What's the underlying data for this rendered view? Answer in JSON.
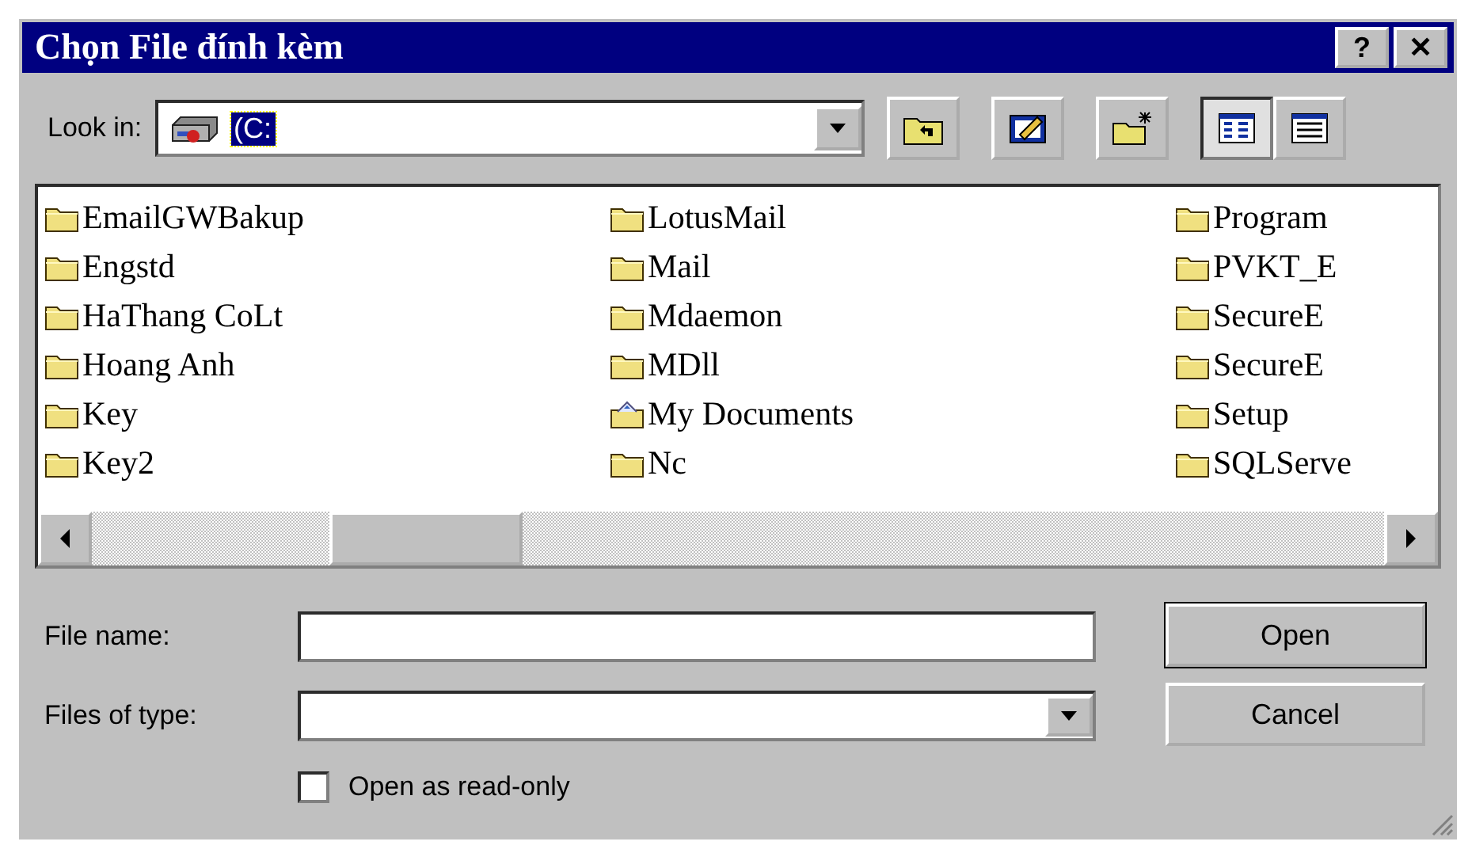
{
  "window": {
    "title": "Chọn File đính kèm",
    "title_buttons": [
      "?",
      "✕"
    ]
  },
  "look_in": {
    "label": "Look in:",
    "value": "(C:",
    "highlighted": true
  },
  "toolbar": [
    {
      "kind": "up",
      "pressed": false
    },
    {
      "kind": "desktop",
      "pressed": false
    },
    {
      "kind": "new-folder",
      "pressed": false
    },
    {
      "kind": "list",
      "pressed": true
    },
    {
      "kind": "details",
      "pressed": false
    }
  ],
  "files": [
    [
      {
        "name": "EmailGWBakup",
        "kind": "folder"
      },
      {
        "name": "Engstd",
        "kind": "folder"
      },
      {
        "name": "HaThang CoLt",
        "kind": "folder"
      },
      {
        "name": "Hoang Anh",
        "kind": "folder"
      },
      {
        "name": "Key",
        "kind": "folder"
      },
      {
        "name": "Key2",
        "kind": "folder"
      }
    ],
    [
      {
        "name": "LotusMail",
        "kind": "folder"
      },
      {
        "name": "Mail",
        "kind": "folder"
      },
      {
        "name": "Mdaemon",
        "kind": "folder"
      },
      {
        "name": "MDll",
        "kind": "folder"
      },
      {
        "name": "My Documents",
        "kind": "documents"
      },
      {
        "name": "Nc",
        "kind": "folder"
      }
    ],
    [
      {
        "name": "Program",
        "kind": "folder"
      },
      {
        "name": "PVKT_E",
        "kind": "folder"
      },
      {
        "name": "SecureE",
        "kind": "folder"
      },
      {
        "name": "SecureE",
        "kind": "folder"
      },
      {
        "name": "Setup",
        "kind": "folder"
      },
      {
        "name": "SQLServe",
        "kind": "folder"
      }
    ]
  ],
  "file_name": {
    "label": "File name:"
  },
  "file_type": {
    "label": "Files of type:"
  },
  "buttons": [
    {
      "label": "Open",
      "default": true
    },
    {
      "label": "Cancel",
      "default": false
    }
  ],
  "read_only": {
    "label": "Open as read-only",
    "checked": false
  }
}
